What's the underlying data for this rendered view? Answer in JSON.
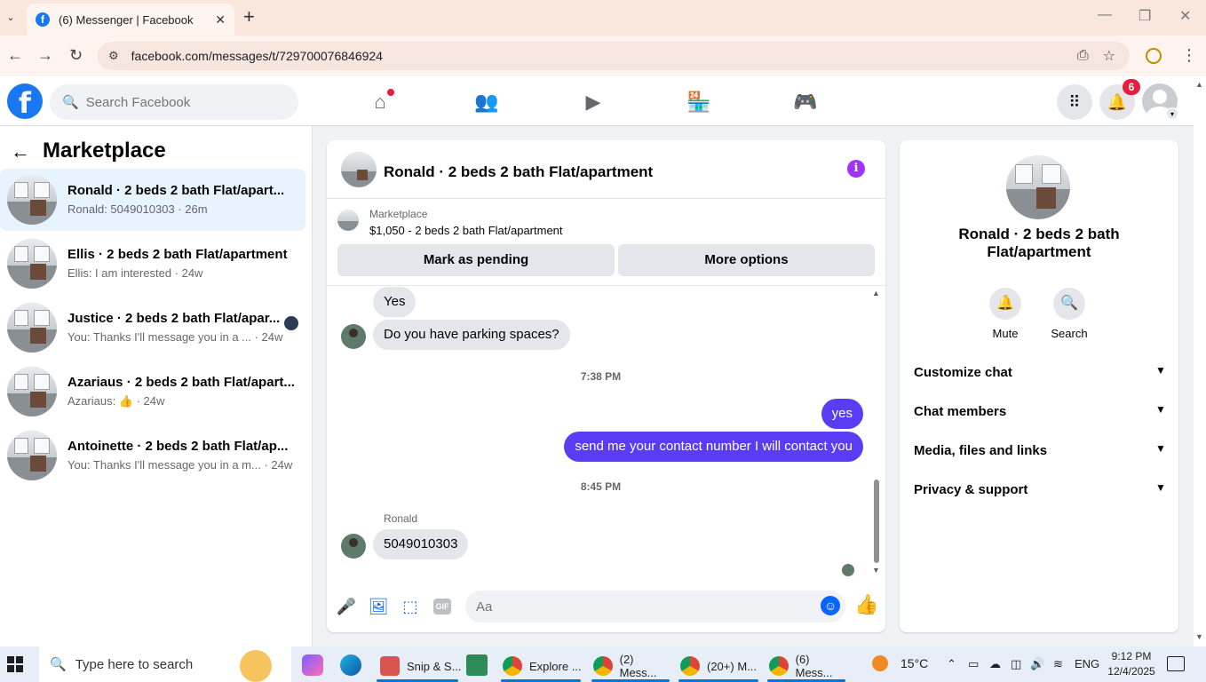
{
  "browser": {
    "tab_title": "(6) Messenger | Facebook",
    "url": "facebook.com/messages/t/729700076846924",
    "favicon_letter": "f"
  },
  "fb": {
    "logo_letter": "f",
    "search_placeholder": "Search Facebook",
    "notifications_count": "6"
  },
  "left": {
    "title": "Marketplace",
    "conversations": [
      {
        "name": "Ronald · 2 beds 2 bath Flat/apart...",
        "preview": "Ronald: 5049010303 · 26m",
        "active": true
      },
      {
        "name": "Ellis · 2 beds 2 bath Flat/apartment",
        "preview": "Ellis: I am interested · 24w"
      },
      {
        "name": "Justice · 2 beds 2 bath Flat/apar...",
        "preview": "You: Thanks I'll message you in a ... · 24w"
      },
      {
        "name": "Azariaus · 2 beds 2 bath Flat/apart...",
        "preview": "Azariaus: 👍 · 24w"
      },
      {
        "name": "Antoinette · 2 beds 2 bath Flat/ap...",
        "preview": "You: Thanks I'll message you in a m... · 24w"
      }
    ]
  },
  "chat": {
    "title": "Ronald · 2 beds 2 bath Flat/apartment",
    "marketplace_label": "Marketplace",
    "listing": "$1,050 - 2 beds 2 bath Flat/apartment",
    "mark_pending_label": "Mark as pending",
    "more_options_label": "More options",
    "messages": {
      "m1": "Yes",
      "m2": "Do you have parking spaces?",
      "t1": "7:38 PM",
      "m3": "yes",
      "m4": "send me your contact number I will contact you",
      "t2": "8:45 PM",
      "sender": "Ronald",
      "m5": "5049010303"
    },
    "composer_placeholder": "Aa",
    "gif_label": "GIF"
  },
  "right": {
    "title": "Ronald · 2 beds 2 bath Flat/apartment",
    "mute_label": "Mute",
    "search_label": "Search",
    "sections": [
      "Customize chat",
      "Chat members",
      "Media, files and links",
      "Privacy & support"
    ]
  },
  "taskbar": {
    "search_placeholder": "Type here to search",
    "apps": [
      "Snip & S...",
      "Explore ...",
      "(2) Mess...",
      "(20+) M...",
      "(6) Mess..."
    ],
    "weather": "15°C",
    "lang": "ENG",
    "time": "9:12 PM",
    "date": "12/4/2025"
  },
  "colors": {
    "facebook_blue": "#1877f2",
    "outgoing_bubble": "#5b3cf5",
    "info_purple": "#a033ff",
    "notification_red": "#e41e3f"
  }
}
